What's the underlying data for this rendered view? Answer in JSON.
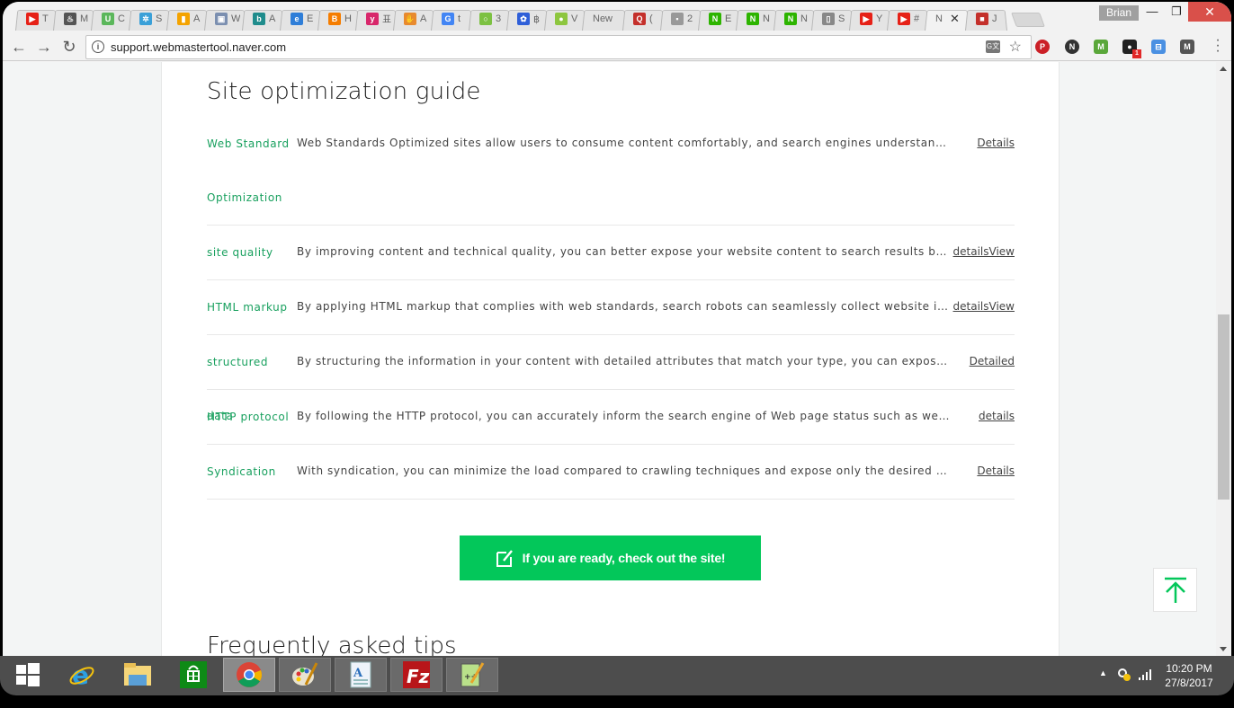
{
  "browser": {
    "tabs": [
      {
        "icon": "youtube-icon",
        "color": "#e62117",
        "glyph": "▶",
        "title": "T"
      },
      {
        "icon": "flame-icon",
        "color": "#555555",
        "glyph": "♨",
        "title": "M"
      },
      {
        "icon": "u-icon",
        "color": "#5bb75b",
        "glyph": "U",
        "title": "C"
      },
      {
        "icon": "ripple-icon",
        "color": "#3aa0d8",
        "glyph": "✲",
        "title": "S"
      },
      {
        "icon": "analytics-icon",
        "color": "#f4a300",
        "glyph": "▮",
        "title": "A"
      },
      {
        "icon": "webmaster-icon",
        "color": "#7b8fb0",
        "glyph": "▣",
        "title": "W"
      },
      {
        "icon": "bing-icon",
        "color": "#1f8c8c",
        "glyph": "b",
        "title": "A"
      },
      {
        "icon": "ie-e-icon",
        "color": "#2f7ed8",
        "glyph": "e",
        "title": "E"
      },
      {
        "icon": "blogger-icon",
        "color": "#f57d00",
        "glyph": "B",
        "title": "H"
      },
      {
        "icon": "yoast-icon",
        "color": "#d8276b",
        "glyph": "y",
        "title": "표"
      },
      {
        "icon": "hand-icon",
        "color": "#e88a2e",
        "glyph": "✋",
        "title": "A"
      },
      {
        "icon": "google-icon",
        "color": "#4285f4",
        "glyph": "G",
        "title": "t"
      },
      {
        "icon": "circle-icon",
        "color": "#7cc142",
        "glyph": "○",
        "title": "3"
      },
      {
        "icon": "paw-icon",
        "color": "#2f5fd8",
        "glyph": "✿",
        "title": "฿"
      },
      {
        "icon": "chat-bubble-icon",
        "color": "#8dc63f",
        "glyph": "●",
        "title": "V"
      },
      {
        "icon": "none",
        "color": "",
        "glyph": "",
        "title": "New"
      },
      {
        "icon": "quora-icon",
        "color": "#c4302b",
        "glyph": "Q",
        "title": "("
      },
      {
        "icon": "image-icon",
        "color": "#999999",
        "glyph": "▪",
        "title": "2"
      },
      {
        "icon": "naver-icon",
        "color": "#2db400",
        "glyph": "N",
        "title": "E"
      },
      {
        "icon": "naver-icon",
        "color": "#2db400",
        "glyph": "N",
        "title": "N"
      },
      {
        "icon": "naver-icon",
        "color": "#2db400",
        "glyph": "N",
        "title": "N"
      },
      {
        "icon": "document-icon",
        "color": "#888888",
        "glyph": "▯",
        "title": "S"
      },
      {
        "icon": "youtube-icon",
        "color": "#e62117",
        "glyph": "▶",
        "title": "Y"
      },
      {
        "icon": "youtube-icon",
        "color": "#e62117",
        "glyph": "▶",
        "title": "#"
      },
      {
        "icon": "none",
        "color": "",
        "glyph": "",
        "title": "N",
        "active": true
      },
      {
        "icon": "square-icon",
        "color": "#c4302b",
        "glyph": "■",
        "title": "J"
      }
    ],
    "profile_name": "Brian",
    "url": "support.webmastertool.naver.com",
    "extensions": [
      {
        "name": "pinterest-icon",
        "color": "#cb2027",
        "glyph": "P"
      },
      {
        "name": "naver-n-icon",
        "color": "#333333",
        "glyph": "N"
      },
      {
        "name": "shield-m-icon",
        "color": "#5aa73a",
        "glyph": "M"
      },
      {
        "name": "mask-extension-icon",
        "color": "#222222",
        "glyph": "●",
        "badge": "1"
      },
      {
        "name": "tag-extension-icon",
        "color": "#4a90e2",
        "glyph": "⊟"
      },
      {
        "name": "m-extension-icon",
        "color": "#555555",
        "glyph": "M"
      }
    ]
  },
  "page": {
    "section_title": "Site optimization guide",
    "guide_items": [
      {
        "label": "Web Standard Optimization",
        "description": "Web Standards Optimized sites allow users to consume content comfortably, and search engines understand the structure of the site more accurately.",
        "link": "Details"
      },
      {
        "label": "site quality",
        "description": "By improving content and technical quality, you can better expose your website content to search results based on quality.",
        "link": "detailsView"
      },
      {
        "label": "HTML markup",
        "description": "By applying HTML markup that complies with web standards, search robots can seamlessly collect website information.",
        "link": "detailsView"
      },
      {
        "label": "structured data",
        "description": "By structuring the information in your content with detailed attributes that match your type, you can expose your website richly.",
        "link": "Detailed"
      },
      {
        "label": "HTTP protocol",
        "description": "By following the HTTP protocol, you can accurately inform the search engine of Web page status such as web site deletion.",
        "link": "details"
      },
      {
        "label": "Syndication",
        "description": "With syndication, you can minimize the load compared to crawling techniques and expose only the desired portion of content.",
        "link": "Details"
      }
    ],
    "cta_label": "If you are ready, check out the site!",
    "faq_title": "Frequently asked tips",
    "accent_color": "#03c75a",
    "label_color": "#18a05e"
  },
  "taskbar": {
    "apps": [
      "start-icon",
      "internet-explorer-icon",
      "file-explorer-icon",
      "store-icon",
      "chrome-icon",
      "paint-icon",
      "wordpad-icon",
      "filezilla-icon",
      "notepad-plus-plus-icon"
    ],
    "time": "10:20 PM",
    "date": "27/8/2017"
  }
}
